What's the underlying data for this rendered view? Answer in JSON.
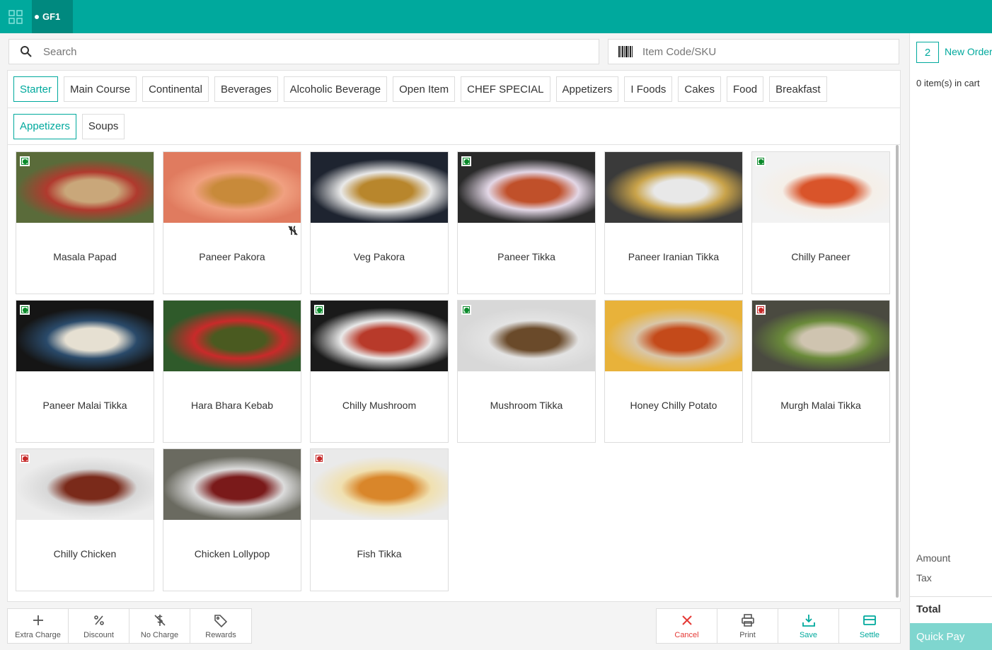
{
  "topbar": {
    "table_label": "GF1"
  },
  "search": {
    "placeholder": "Search",
    "sku_placeholder": "Item Code/SKU"
  },
  "categories": [
    "Starter",
    "Main Course",
    "Continental",
    "Beverages",
    "Alcoholic Beverage",
    "Open Item",
    "CHEF SPECIAL",
    "Appetizers",
    "I Foods",
    "Cakes",
    "Food",
    "Breakfast"
  ],
  "active_category": "Starter",
  "subcategories": [
    "Appetizers",
    "Soups"
  ],
  "active_subcategory": "Appetizers",
  "items": [
    {
      "name": "Masala Papad",
      "mark": "veg",
      "colors": [
        "#5a6b3a",
        "#c9a77a",
        "#b03a2e"
      ]
    },
    {
      "name": "Paneer Pakora",
      "mark": "none",
      "no_food": true,
      "colors": [
        "#e07b5f",
        "#c88a3a",
        "#f0a080"
      ]
    },
    {
      "name": "Veg Pakora",
      "mark": "none",
      "colors": [
        "#1e2430",
        "#b8862c",
        "#e9e9e9"
      ]
    },
    {
      "name": "Paneer Tikka",
      "mark": "veg",
      "colors": [
        "#2a2a2a",
        "#c0502a",
        "#e3d7e6"
      ]
    },
    {
      "name": "Paneer Iranian Tikka",
      "mark": "none",
      "colors": [
        "#3a3a3a",
        "#e8e8e8",
        "#c9a34a"
      ]
    },
    {
      "name": "Chilly Paneer",
      "mark": "veg",
      "colors": [
        "#f2f2f2",
        "#d9542a",
        "#f5efe8"
      ]
    },
    {
      "name": "Paneer Malai Tikka",
      "mark": "veg",
      "colors": [
        "#151515",
        "#e6e0d2",
        "#2a4a6a"
      ]
    },
    {
      "name": "Hara Bhara Kebab",
      "mark": "none",
      "colors": [
        "#2f5a2a",
        "#4a5a20",
        "#c92a2a"
      ]
    },
    {
      "name": "Chilly Mushroom",
      "mark": "veg",
      "colors": [
        "#1a1a1a",
        "#b83a2a",
        "#e9e9e9"
      ]
    },
    {
      "name": "Mushroom Tikka",
      "mark": "veg",
      "colors": [
        "#d8d8d8",
        "#6a4a2a",
        "#e3e3e3"
      ]
    },
    {
      "name": "Honey Chilly Potato",
      "mark": "none",
      "colors": [
        "#e8b23a",
        "#c44a1a",
        "#d9c6a8"
      ]
    },
    {
      "name": "Murgh Malai Tikka",
      "mark": "nonveg",
      "colors": [
        "#4a4a40",
        "#cfc4b0",
        "#6a8a3a"
      ]
    },
    {
      "name": "Chilly Chicken",
      "mark": "nonveg",
      "colors": [
        "#ececec",
        "#7a2a1a",
        "#d8d8d8"
      ]
    },
    {
      "name": "Chicken Lollypop",
      "mark": "none",
      "colors": [
        "#6a6a60",
        "#7a1a1a",
        "#dcdcdc"
      ]
    },
    {
      "name": "Fish Tikka",
      "mark": "nonveg",
      "colors": [
        "#eaeaea",
        "#d9862a",
        "#f0e0b0"
      ]
    }
  ],
  "toolbar_left": [
    {
      "label": "Extra Charge",
      "icon": "plus-icon"
    },
    {
      "label": "Discount",
      "icon": "percent-icon"
    },
    {
      "label": "No Charge",
      "icon": "no-charge-icon"
    },
    {
      "label": "Rewards",
      "icon": "tag-icon"
    }
  ],
  "toolbar_right": [
    {
      "label": "Cancel",
      "icon": "close-icon",
      "color": "#e53935"
    },
    {
      "label": "Print",
      "icon": "printer-icon",
      "color": "#555555"
    },
    {
      "label": "Save",
      "icon": "download-icon",
      "color": "#00a99d"
    },
    {
      "label": "Settle",
      "icon": "card-icon",
      "color": "#00a99d"
    }
  ],
  "cart": {
    "order_number": "2",
    "new_order_label": "New Order",
    "count_text": "0 item(s) in cart",
    "amount_label": "Amount",
    "tax_label": "Tax",
    "total_label": "Total",
    "quick_pay_label": "Quick Pay"
  },
  "colors": {
    "brand": "#00a99d",
    "veg": "#0a8a2a",
    "nonveg": "#c62828"
  }
}
